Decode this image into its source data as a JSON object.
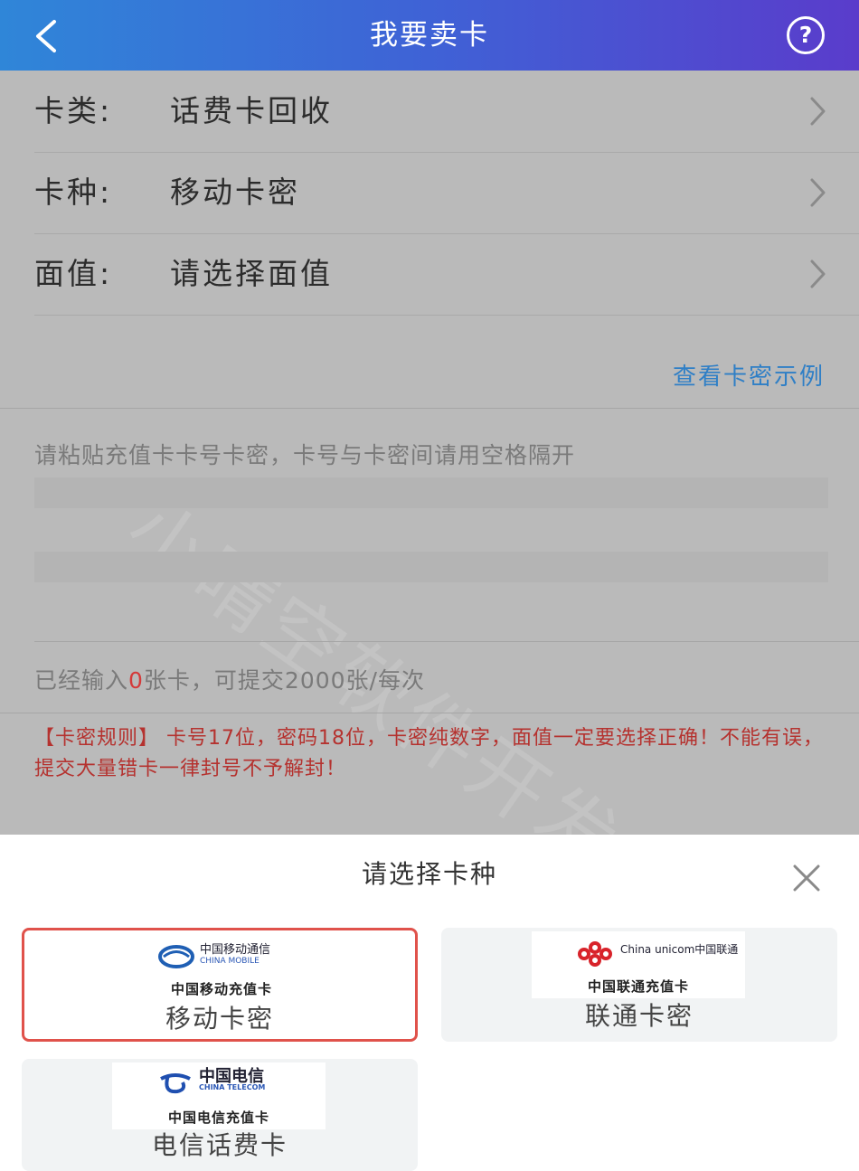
{
  "header": {
    "title": "我要卖卡",
    "back_icon": "chevron-left-icon",
    "help_label": "?"
  },
  "form": {
    "rows": [
      {
        "label": "卡类:",
        "value": "话费卡回收"
      },
      {
        "label": "卡种:",
        "value": "移动卡密"
      },
      {
        "label": "面值:",
        "value": "请选择面值"
      }
    ],
    "example_link": "查看卡密示例",
    "paste_placeholder": "请粘贴充值卡卡号卡密，卡号与卡密间请用空格隔开",
    "count_prefix": "已经输入",
    "count_value": "0",
    "count_suffix": "张卡，可提交2000张/每次",
    "rules": "【卡密规则】 卡号17位，密码18位，卡密纯数字，面值一定要选择正确！不能有误，提交大量错卡一律封号不予解封！",
    "watermark": "小晴空软件开发"
  },
  "sheet": {
    "title": "请选择卡种",
    "cards": [
      {
        "brand_cn": "中国移动通信",
        "brand_en": "CHINA MOBILE",
        "caption": "中国移动充值卡",
        "name": "移动卡密",
        "selected": true
      },
      {
        "brand_cn": "China unicom中国联通",
        "brand_en": "",
        "caption": "中国联通充值卡",
        "name": "联通卡密",
        "selected": false
      },
      {
        "brand_cn": "中国电信",
        "brand_en": "CHINA TELECOM",
        "caption": "中国电信充值卡",
        "name": "电信话费卡",
        "selected": false
      }
    ]
  },
  "colors": {
    "accent_blue": "#2f7fc6",
    "rules_red": "#b5322f",
    "selected_border": "#e0524b"
  }
}
